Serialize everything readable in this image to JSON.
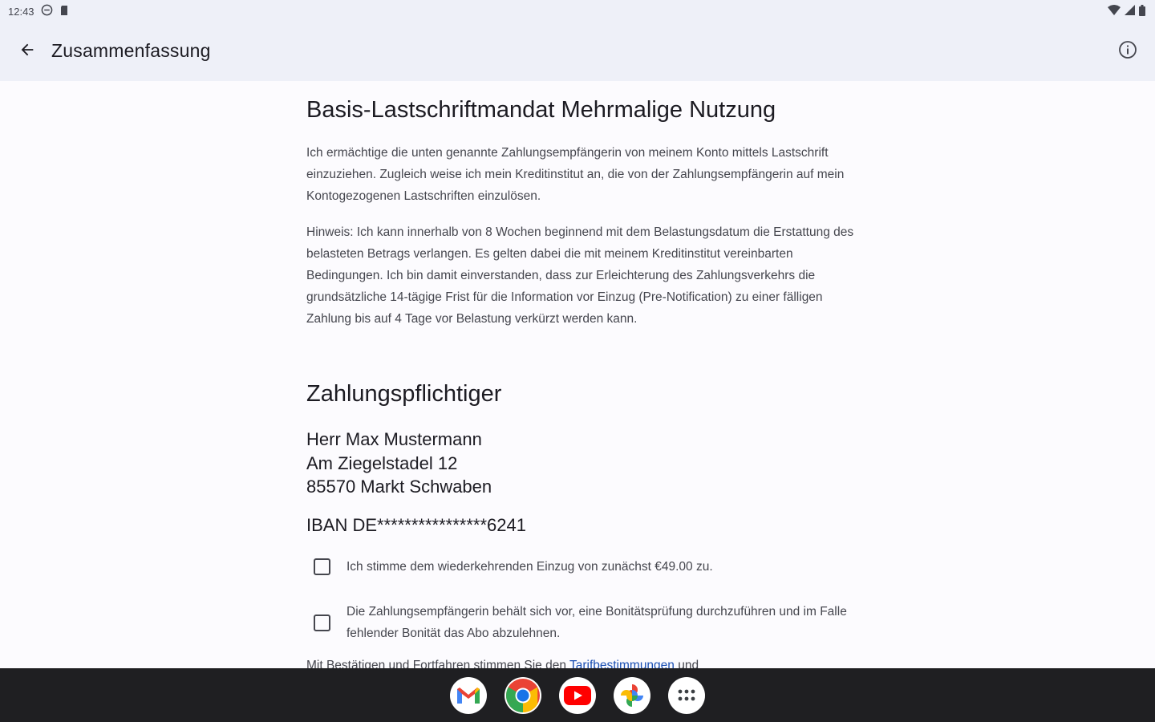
{
  "status_bar": {
    "time": "12:43",
    "icons_left": [
      "dnd-icon",
      "sim-card-icon"
    ],
    "icons_right": [
      "wifi-icon",
      "signal-icon",
      "battery-icon"
    ]
  },
  "app_bar": {
    "title": "Zusammenfassung",
    "back_icon": "arrow-back-icon",
    "info_icon": "info-icon"
  },
  "mandate": {
    "title": "Basis-Lastschriftmandat Mehrmalige Nutzung",
    "paragraph1": "Ich ermächtige die unten genannte Zahlungsempfängerin von meinem Konto mittels Lastschrift einzuziehen. Zugleich weise ich mein Kreditinstitut an, die von der Zahlungsempfängerin auf mein Kontogezogenen Lastschriften einzulösen.",
    "paragraph2": "Hinweis: Ich kann innerhalb von 8 Wochen beginnend mit dem Belastungsdatum die Erstattung des belasteten Betrags verlangen. Es gelten dabei die mit meinem Kreditinstitut vereinbarten Bedingungen. Ich bin damit einverstanden, dass zur Erleichterung des Zahlungsverkehrs die grundsätzliche 14-tägige Frist für die Information vor Einzug (Pre-Notification) zu einer fälligen Zahlung bis auf 4 Tage vor Belastung verkürzt werden kann."
  },
  "payer": {
    "heading": "Zahlungspflichtiger",
    "name": "Herr Max Mustermann",
    "street": "Am Ziegelstadel 12",
    "city": "85570 Markt Schwaben",
    "iban": "IBAN DE****************6241"
  },
  "checkboxes": [
    {
      "label": "Ich stimme dem wiederkehrenden Einzug von zunächst €49.00 zu.",
      "checked": false
    },
    {
      "label": "Die Zahlungsempfängerin behält sich vor, eine Bonitätsprüfung durchzuführen und im Falle fehlender Bonität das Abo abzulehnen.",
      "checked": false
    }
  ],
  "footer": {
    "text_before": "Mit Bestätigen und Fortfahren stimmen Sie den ",
    "link": "Tarifbestimmungen",
    "text_after": " und"
  },
  "taskbar": {
    "apps": [
      "gmail-icon",
      "chrome-icon",
      "youtube-icon",
      "photos-icon",
      "app-drawer-icon"
    ]
  },
  "colors": {
    "app_bar_bg": "#eef0f8",
    "page_bg": "#fcfbfe",
    "link": "#1a4fb3",
    "taskbar_bg": "#1f1f22"
  }
}
